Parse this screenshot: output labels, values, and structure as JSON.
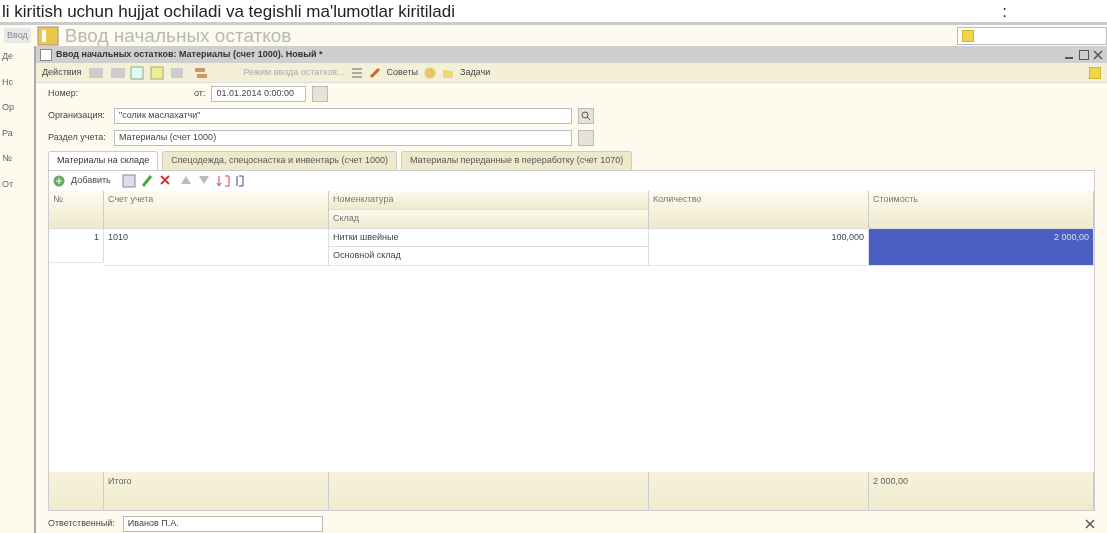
{
  "slide_text": "li kiritish uchun hujjat ochiladi va tegishli ma'lumotlar kiritiladi",
  "slide_mark": ":",
  "background_window": {
    "tab": "Ввод",
    "title": "Ввод начальных остатков",
    "side_labels": [
      "Де",
      "Нс",
      "Ор",
      "Ра",
      "№",
      "От"
    ]
  },
  "window": {
    "title": "Ввод начальных остатков: Материалы (счет 1000). Новый *"
  },
  "toolbar": {
    "actions_menu": "Действия",
    "mode_button": {
      "label": "Режим ввода остатков...",
      "disabled": true
    },
    "tips_button": "Советы",
    "tasks_button": "Задачи"
  },
  "form": {
    "number_label": "Номер:",
    "date_label": "от:",
    "date_value": "01.01.2014 0:00:00",
    "org_label": "Организация:",
    "org_value": "\"солик маслахатчи\"",
    "section_label": "Раздел учета:",
    "section_value": "Материалы (счет 1000)"
  },
  "tabs": [
    {
      "label": "Материалы на складе",
      "selected": true
    },
    {
      "label": "Спецодежда, спецоснастка и инвентарь (счет 1000)",
      "selected": false
    },
    {
      "label": "Материалы переданные в переработку (счет 1070)",
      "selected": false
    }
  ],
  "table_toolbar": {
    "add_button": "Добавить"
  },
  "table": {
    "columns": [
      {
        "label": "№"
      },
      {
        "label": "Счет учета"
      },
      {
        "label": "Номенклатура",
        "sublabel": "Склад"
      },
      {
        "label": "Количество"
      },
      {
        "label": "Стоимость"
      }
    ],
    "rows": [
      {
        "number": "1",
        "account": "1010",
        "item": "Нитки швейные",
        "warehouse": "Основной склад",
        "quantity": "100,000",
        "cost": "2 000,00",
        "selected": true
      }
    ],
    "footer": {
      "label": "Итого",
      "cost_total": "2 000,00"
    }
  },
  "responsible": {
    "label": "Ответственный:",
    "value": "Иванов П.А."
  }
}
